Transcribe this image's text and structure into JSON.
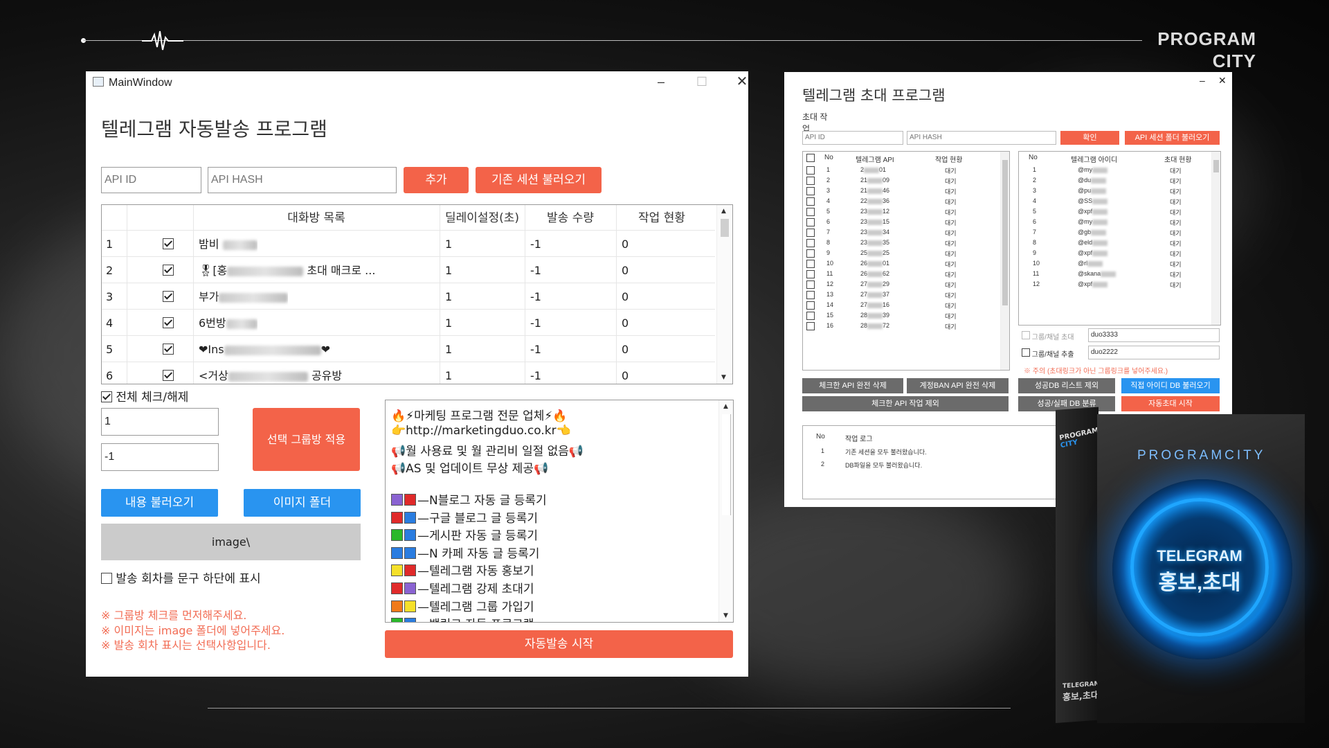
{
  "brand": {
    "line1": "PROGRAM",
    "line2": "CITY"
  },
  "windowA": {
    "title": "MainWindow",
    "app_title": "텔레그램 자동발송 프로그램",
    "api_id_placeholder": "API ID",
    "api_hash_placeholder": "API HASH",
    "add_label": "추가",
    "load_session_label": "기존 세션 불러오기",
    "headers": [
      "대화방 목록",
      "딜레이설정(초)",
      "발송 수량",
      "작업 현황"
    ],
    "rows": [
      {
        "no": "1",
        "checked": true,
        "name_prefix": "밤비",
        "delay": "1",
        "count": "-1",
        "status": "0"
      },
      {
        "no": "2",
        "checked": true,
        "name_prefix": "🎖[홍",
        "name_suffix": "초대 매크로 ...",
        "delay": "1",
        "count": "-1",
        "status": "0"
      },
      {
        "no": "3",
        "checked": true,
        "name_prefix": "부가",
        "delay": "1",
        "count": "-1",
        "status": "0"
      },
      {
        "no": "4",
        "checked": true,
        "name_prefix": "6번방",
        "delay": "1",
        "count": "-1",
        "status": "0"
      },
      {
        "no": "5",
        "checked": true,
        "name_prefix": "❤Ins",
        "name_suffix": "❤",
        "delay": "1",
        "count": "-1",
        "status": "0"
      },
      {
        "no": "6",
        "checked": true,
        "name_prefix": "<거상",
        "name_suffix": "공유방",
        "delay": "1",
        "count": "-1",
        "status": "0"
      }
    ],
    "check_all_label": "전체 체크/해제",
    "delay_value": "1",
    "count_value": "-1",
    "apply_label": "선택 그룹방 적용",
    "load_content_label": "내용 불러오기",
    "image_folder_label": "이미지 폴더",
    "image_path": "image\\",
    "show_round_label": "발송 회차를 문구 하단에 표시",
    "warnings": [
      "※ 그룹방 체크를 먼저해주세요.",
      "※ 이미지는 image 폴더에 넣어주세요.",
      "※ 발송 회차 표시는 선택사항입니다."
    ],
    "message_lines": [
      "🔥⚡마케팅 프로그램 전문 업체⚡🔥",
      "👉http://marketingduo.co.kr👈",
      "📢월 사용료 및 월 관리비 일절 없음📢",
      "📢AS 및 업데이트 무상 제공📢"
    ],
    "products": [
      {
        "c1": "#8a63d2",
        "c2": "#e02a2a",
        "label": "—N블로그 자동 글 등록기"
      },
      {
        "c1": "#e02a2a",
        "c2": "#2a7de0",
        "label": "—구글 블로그 글 등록기"
      },
      {
        "c1": "#2ab82a",
        "c2": "#2a7de0",
        "label": "—게시판 자동 글 등록기"
      },
      {
        "c1": "#2a7de0",
        "c2": "#2a7de0",
        "label": "—N 카페 자동 글 등록기"
      },
      {
        "c1": "#f5e02a",
        "c2": "#e02a2a",
        "label": "—텔레그램 자동 홍보기"
      },
      {
        "c1": "#e02a2a",
        "c2": "#8a63d2",
        "label": "—텔레그램 강제 초대기"
      },
      {
        "c1": "#f07a1a",
        "c2": "#f5e02a",
        "label": "—텔레그램 그룹 가입기"
      },
      {
        "c1": "#2ab82a",
        "c2": "#2a7de0",
        "label": "—백링크 자동 프로그램"
      }
    ],
    "start_label": "자동발송 시작"
  },
  "windowB": {
    "app_title": "텔레그램 초대 프로그램",
    "tab": "초대 작업",
    "api_id_placeholder": "API ID",
    "api_hash_placeholder": "API HASH",
    "confirm_label": "확인",
    "load_folder_label": "API 세션 폴더 불러오기",
    "left_headers": [
      "No",
      "텔레그램 API",
      "작업 현황"
    ],
    "left_rows": [
      {
        "no": "1",
        "api": "2",
        "tail": "01",
        "status": "대기"
      },
      {
        "no": "2",
        "api": "21",
        "tail": "09",
        "status": "대기"
      },
      {
        "no": "3",
        "api": "21",
        "tail": "46",
        "status": "대기"
      },
      {
        "no": "4",
        "api": "22",
        "tail": "36",
        "status": "대기"
      },
      {
        "no": "5",
        "api": "23",
        "tail": "12",
        "status": "대기"
      },
      {
        "no": "6",
        "api": "23",
        "tail": "15",
        "status": "대기"
      },
      {
        "no": "7",
        "api": "23",
        "tail": "34",
        "status": "대기"
      },
      {
        "no": "8",
        "api": "23",
        "tail": "35",
        "status": "대기"
      },
      {
        "no": "9",
        "api": "25",
        "tail": "25",
        "status": "대기"
      },
      {
        "no": "10",
        "api": "26",
        "tail": "01",
        "status": "대기"
      },
      {
        "no": "11",
        "api": "26",
        "tail": "62",
        "status": "대기"
      },
      {
        "no": "12",
        "api": "27",
        "tail": "29",
        "status": "대기"
      },
      {
        "no": "13",
        "api": "27",
        "tail": "37",
        "status": "대기"
      },
      {
        "no": "14",
        "api": "27",
        "tail": "16",
        "status": "대기"
      },
      {
        "no": "15",
        "api": "28",
        "tail": "39",
        "status": "대기"
      },
      {
        "no": "16",
        "api": "28",
        "tail": "72",
        "status": "대기"
      }
    ],
    "right_headers": [
      "No",
      "텔레그램 아이디",
      "초대 현황"
    ],
    "right_rows": [
      {
        "no": "1",
        "id": "@my",
        "status": "대기"
      },
      {
        "no": "2",
        "id": "@du",
        "status": "대기"
      },
      {
        "no": "3",
        "id": "@pu",
        "status": "대기"
      },
      {
        "no": "4",
        "id": "@SS",
        "status": "대기"
      },
      {
        "no": "5",
        "id": "@xpf",
        "status": "대기"
      },
      {
        "no": "6",
        "id": "@my",
        "status": "대기"
      },
      {
        "no": "7",
        "id": "@gb",
        "status": "대기"
      },
      {
        "no": "8",
        "id": "@eld",
        "status": "대기"
      },
      {
        "no": "9",
        "id": "@xpf",
        "status": "대기"
      },
      {
        "no": "10",
        "id": "@rl",
        "status": "대기"
      },
      {
        "no": "11",
        "id": "@skana",
        "status": "대기"
      },
      {
        "no": "12",
        "id": "@xpf",
        "status": "대기"
      }
    ],
    "invite_label": "그룹/채널 초대",
    "invite_value": "duo3333",
    "extract_label": "그룹/채널 추출",
    "extract_value": "duo2222",
    "note": "※ 주의 (초대링크가 아닌 그룹링크를 넣어주세요.)",
    "btn_delete_checked": "체크한 API 완전 삭제",
    "btn_delete_banned": "계정BAN API 완전 삭제",
    "btn_exclude_checked": "체크한 API 작업 제외",
    "btn_success_exclude": "성공DB 리스트 제외",
    "btn_load_id_db": "직접 아이디 DB 불러오기",
    "btn_classify": "성공/실패 DB 분류",
    "btn_auto_invite": "자동초대 시작",
    "log_headers": [
      "No",
      "작업 로그"
    ],
    "log_rows": [
      {
        "no": "1",
        "msg": "기존 세션을 모두 불러왔습니다."
      },
      {
        "no": "2",
        "msg": "DB파일을 모두 불러왔습니다."
      }
    ]
  },
  "box": {
    "brand_small_1": "PROGRAM",
    "brand_small_2": "CITY",
    "brand_large": "PROGRAMCITY",
    "logo_line1": "TELEGRAM",
    "logo_line2": "홍보,초대",
    "side_line1": "TELEGRAM",
    "side_line2": "홍보,초대"
  }
}
